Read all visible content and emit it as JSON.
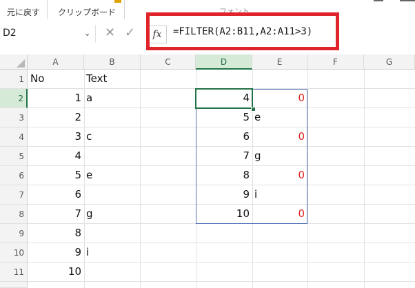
{
  "ribbon": {
    "undo_group_label": "元に戻す",
    "clipboard_group_label": "クリップボード",
    "font_group_label": "フォント"
  },
  "name_box": {
    "value": "D2"
  },
  "formula_bar": {
    "fx_label": "fx",
    "formula": "=FILTER(A2:B11,A2:A11>3)"
  },
  "sheet": {
    "columns": [
      "A",
      "B",
      "C",
      "D",
      "E",
      "F",
      "G"
    ],
    "active_column": "D",
    "rows": [
      "1",
      "2",
      "3",
      "4",
      "5",
      "6",
      "7",
      "8",
      "9",
      "10",
      "11"
    ],
    "active_row": "2",
    "cells": {
      "A1": "No",
      "B1": "Text",
      "A2": "1",
      "B2": "a",
      "A3": "2",
      "A4": "3",
      "B4": "c",
      "A5": "4",
      "A6": "5",
      "B6": "e",
      "A7": "6",
      "A8": "7",
      "B8": "g",
      "A9": "8",
      "A10": "9",
      "B10": "i",
      "A11": "10",
      "D2": "4",
      "E2": "0",
      "D3": "5",
      "E3": "e",
      "D4": "6",
      "E4": "0",
      "D5": "7",
      "E5": "g",
      "D6": "8",
      "E6": "0",
      "D7": "9",
      "E7": "i",
      "D8": "10",
      "E8": "0"
    }
  },
  "colors": {
    "highlight_border": "#e0242b",
    "active_green": "#217346",
    "error_zero_red": "#e02020",
    "spill_border": "#4a6fb5"
  }
}
